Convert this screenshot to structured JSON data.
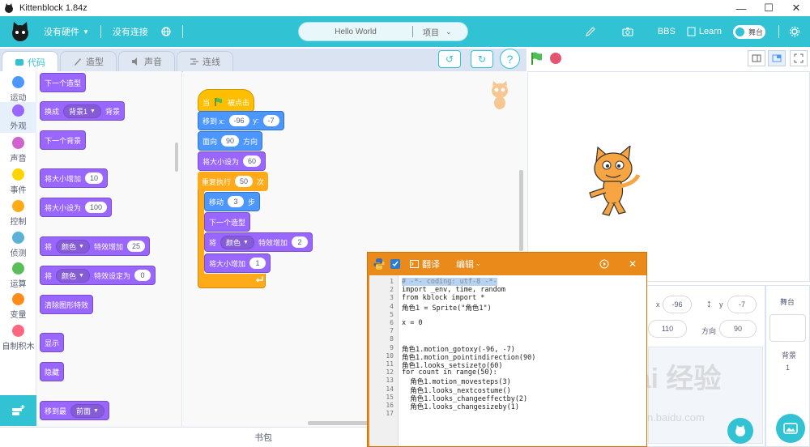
{
  "window": {
    "title": "Kittenblock 1.84z",
    "min": "—",
    "max": "☐",
    "close": "✕"
  },
  "menubar": {
    "hardware": "没有硬件",
    "connection": "没有连接",
    "project_name": "Hello World",
    "project_menu": "项目",
    "bbs": "BBS",
    "learn": "Learn",
    "stage_toggle": "舞台",
    "colors": {
      "bar": "#31c2d3"
    }
  },
  "tabs": [
    {
      "label": "代码",
      "icon": "code-icon"
    },
    {
      "label": "造型",
      "icon": "brush-icon"
    },
    {
      "label": "声音",
      "icon": "speaker-icon"
    },
    {
      "label": "连线",
      "icon": "wire-icon"
    }
  ],
  "categories": [
    {
      "label": "运动",
      "color": "#4c97ff"
    },
    {
      "label": "外观",
      "color": "#9966ff"
    },
    {
      "label": "声音",
      "color": "#cf63cf"
    },
    {
      "label": "事件",
      "color": "#ffd500"
    },
    {
      "label": "控制",
      "color": "#ffab19"
    },
    {
      "label": "侦测",
      "color": "#5cb1d6"
    },
    {
      "label": "运算",
      "color": "#59c059"
    },
    {
      "label": "变量",
      "color": "#ff8c1a"
    },
    {
      "label": "自制积木",
      "color": "#ff6680"
    }
  ],
  "palette": {
    "next_costume": "下一个造型",
    "switch_backdrop_pre": "换成",
    "switch_backdrop_value": "背景1",
    "switch_backdrop_post": "背景",
    "next_backdrop": "下一个背景",
    "change_size": "将大小增加",
    "change_size_value": "10",
    "set_size": "将大小设为",
    "set_size_value": "100",
    "change_effect_pre": "将",
    "change_effect_drop": "颜色",
    "change_effect_post": "特效增加",
    "change_effect_value": "25",
    "set_effect_pre": "将",
    "set_effect_drop": "颜色",
    "set_effect_post": "特效设定为",
    "set_effect_value": "0",
    "clear_effects": "清除图形特效",
    "show": "显示",
    "hide": "隐藏",
    "goto_layer_pre": "移到最",
    "goto_layer_drop": "前面"
  },
  "script": {
    "when_flag_pre": "当",
    "when_flag_post": "被点击",
    "goto_label": "移到 x:",
    "goto_x": "-96",
    "goto_y_label": "y:",
    "goto_y": "-7",
    "point_pre": "面向",
    "point_value": "90",
    "point_post": "方向",
    "set_size": "将大小设为",
    "set_size_value": "60",
    "repeat_pre": "重复执行",
    "repeat_value": "50",
    "repeat_post": "次",
    "move_pre": "移动",
    "move_value": "3",
    "move_post": "步",
    "next_costume": "下一个造型",
    "effect_pre": "将",
    "effect_drop": "颜色",
    "effect_post": "特效增加",
    "effect_value": "2",
    "size_change": "将大小增加",
    "size_change_value": "1"
  },
  "backpack": "书包",
  "sprite_info": {
    "x_label": "x",
    "x_value": "-96",
    "y_label": "y",
    "y_value": "-7",
    "size_value": "110",
    "direction_label": "方向",
    "direction_value": "90",
    "stage_label": "舞台",
    "backdrop_label": "背景",
    "backdrop_count": "1"
  },
  "watermark": {
    "main": "Bai 经验",
    "sub": "jingyan.baidu.com"
  },
  "python": {
    "translate": "翻译",
    "edit": "编辑",
    "line_numbers": [
      "1",
      "2",
      "3",
      "4",
      "5",
      "6",
      "7",
      "8",
      "9",
      "10",
      "11",
      "12",
      "13",
      "14",
      "15",
      "16",
      "17"
    ],
    "lines": [
      "# -*- coding: utf-8 -*-",
      "import _env, time, random",
      "from kblock import *",
      "角色1 = Sprite(\"角色1\")",
      "",
      "x = 0",
      "",
      "",
      "角色1.motion_gotoxy(-96, -7)",
      "角色1.motion_pointindirection(90)",
      "角色1.looks_setsizeto(60)",
      "for count in range(50):",
      "  角色1.motion_movesteps(3)",
      "  角色1.looks_nextcostume()",
      "  角色1.looks_changeeffectby(2)",
      "  角色1.looks_changesizeby(1)",
      ""
    ]
  }
}
